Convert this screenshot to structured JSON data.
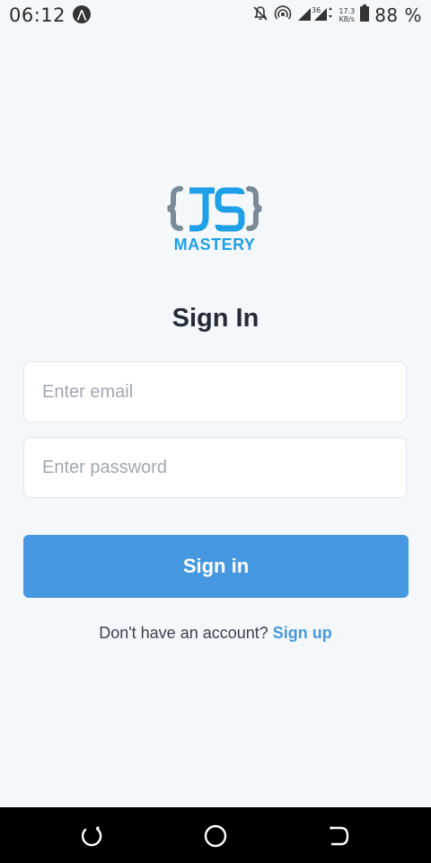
{
  "status_bar": {
    "time": "06:12",
    "net_speed_value": "17.3",
    "net_speed_unit": "KB/s",
    "network_type": "36",
    "battery_percent": "88 %"
  },
  "logo": {
    "mastery_text": "MASTERY",
    "braces_color": "#7a8a96",
    "js_color": "#1ea0e6"
  },
  "page": {
    "title": "Sign In"
  },
  "form": {
    "email": {
      "placeholder": "Enter email",
      "value": ""
    },
    "password": {
      "placeholder": "Enter password",
      "value": ""
    },
    "submit_label": "Sign in"
  },
  "footer": {
    "prompt": "Don't have an account?",
    "link_label": "Sign up"
  },
  "colors": {
    "background": "#f5f8fb",
    "accent": "#4598e0",
    "title": "#232b3b"
  },
  "nav_icons": [
    "recent-apps-icon",
    "home-icon",
    "back-icon"
  ]
}
